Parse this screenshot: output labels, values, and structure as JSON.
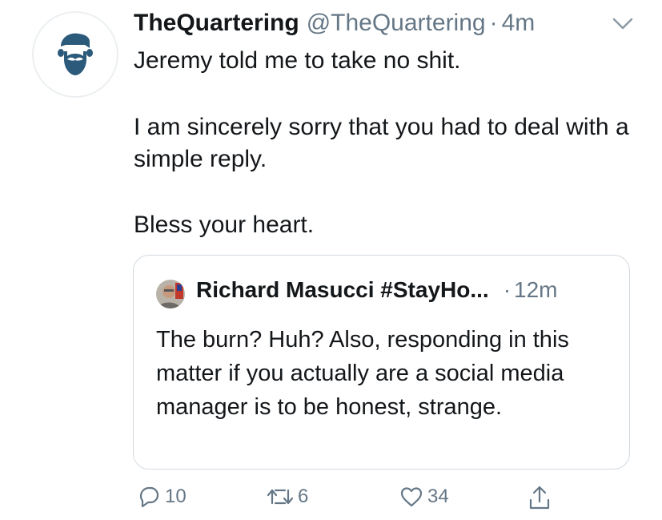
{
  "tweet": {
    "display_name": "TheQuartering",
    "handle": "@TheQuartering",
    "separator": "·",
    "time": "4m",
    "text_line1": "Jeremy told me to take no shit.",
    "text_line2": "I am sincerely sorry that you had to deal with a simple reply.",
    "text_line3": "Bless your heart."
  },
  "quoted_tweet": {
    "display_name": "Richard Masucci #StayHo...",
    "separator": "·",
    "time": "12m",
    "text": "The burn? Huh? Also, responding in this matter if you actually are a social media manager is to be honest, strange."
  },
  "actions": {
    "replies": "10",
    "retweets": "6",
    "likes": "34"
  },
  "icons": {
    "reply": "reply-icon",
    "retweet": "retweet-icon",
    "like": "heart-icon",
    "share": "share-icon",
    "menu": "chevron-down-icon"
  },
  "colors": {
    "text": "#14171a",
    "secondary": "#657786",
    "avatar_accent": "#2b5a7a",
    "border": "#d3dae0"
  }
}
